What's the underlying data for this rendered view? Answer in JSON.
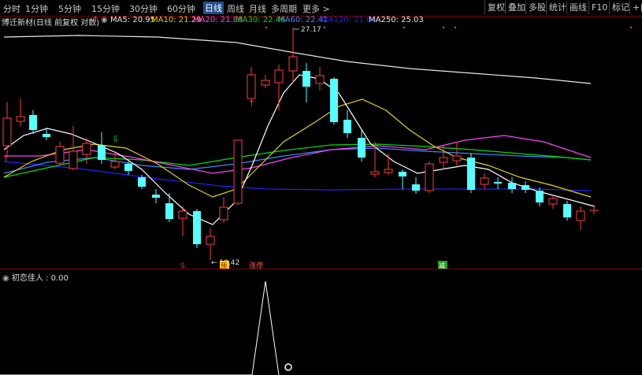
{
  "toolbar": {
    "tabs": [
      "分时",
      "1分钟",
      "5分钟",
      "15分钟",
      "30分钟",
      "60分钟",
      "日线",
      "周线",
      "月线",
      "多周期",
      "更多 >"
    ],
    "active_tab": "日线",
    "right_buttons": [
      "复权",
      "叠加",
      "多股",
      "统计",
      "画线",
      "F10",
      "标记",
      "+自"
    ]
  },
  "info_bar": {
    "stock_title": "博迁新材(日线 前复权 对数)",
    "ma5": "MA5: 20.95",
    "ma10": "MA10: 21.29",
    "ma20": "MA20: 21.88",
    "ma30": "MA30: 22.46",
    "ma60": "MA60: 22.41",
    "ma120": "MA120: 21.64",
    "ma250": "MA250: 25.03"
  },
  "annotations": {
    "high_label": "27.17",
    "low_label": "← 18.42",
    "marker_s": "S",
    "marker_yu": "预",
    "marker_zhangting": "涨停",
    "marker_jian": "减"
  },
  "indicator": {
    "label": "初恋佳人 : 0.00"
  },
  "colors": {
    "background": "#000000",
    "up_candle": "#ff3b3b",
    "down_candle": "#54ffff",
    "ma5": "#ffffff",
    "ma10": "#e6d200",
    "ma20": "#ff40ff",
    "ma30": "#00e000",
    "ma60": "#3a8aff",
    "ma120": "#2020ff",
    "ma250": "#ffffff",
    "separator": "#8a0000"
  }
}
